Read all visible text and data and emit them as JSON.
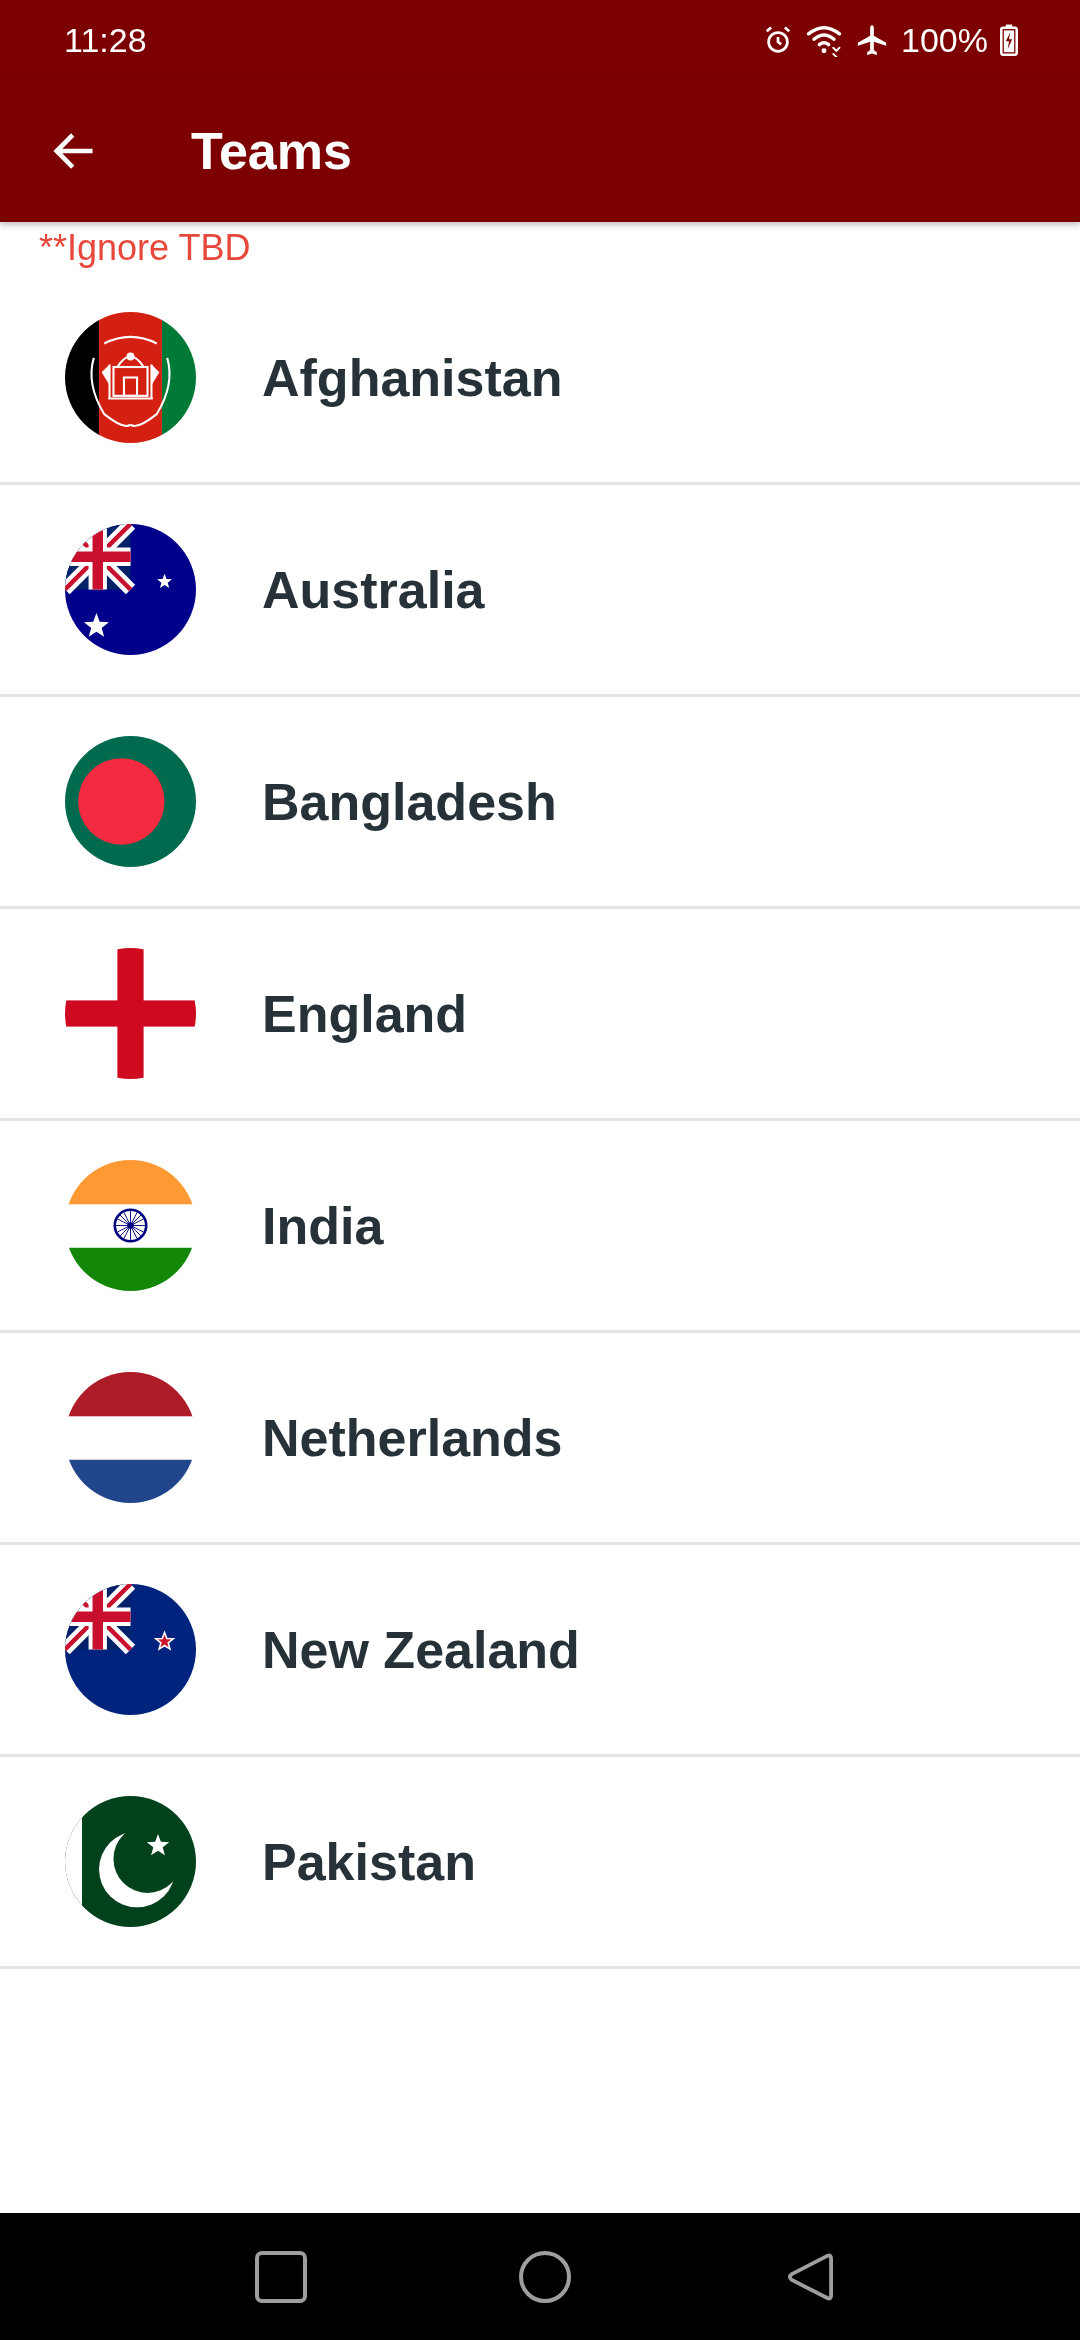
{
  "status_bar": {
    "time": "11:28",
    "battery": "100%"
  },
  "app_bar": {
    "title": "Teams"
  },
  "note": "**Ignore TBD",
  "teams": [
    {
      "name": "Afghanistan"
    },
    {
      "name": "Australia"
    },
    {
      "name": "Bangladesh"
    },
    {
      "name": "England"
    },
    {
      "name": "India"
    },
    {
      "name": "Netherlands"
    },
    {
      "name": "New Zealand"
    },
    {
      "name": "Pakistan"
    }
  ]
}
